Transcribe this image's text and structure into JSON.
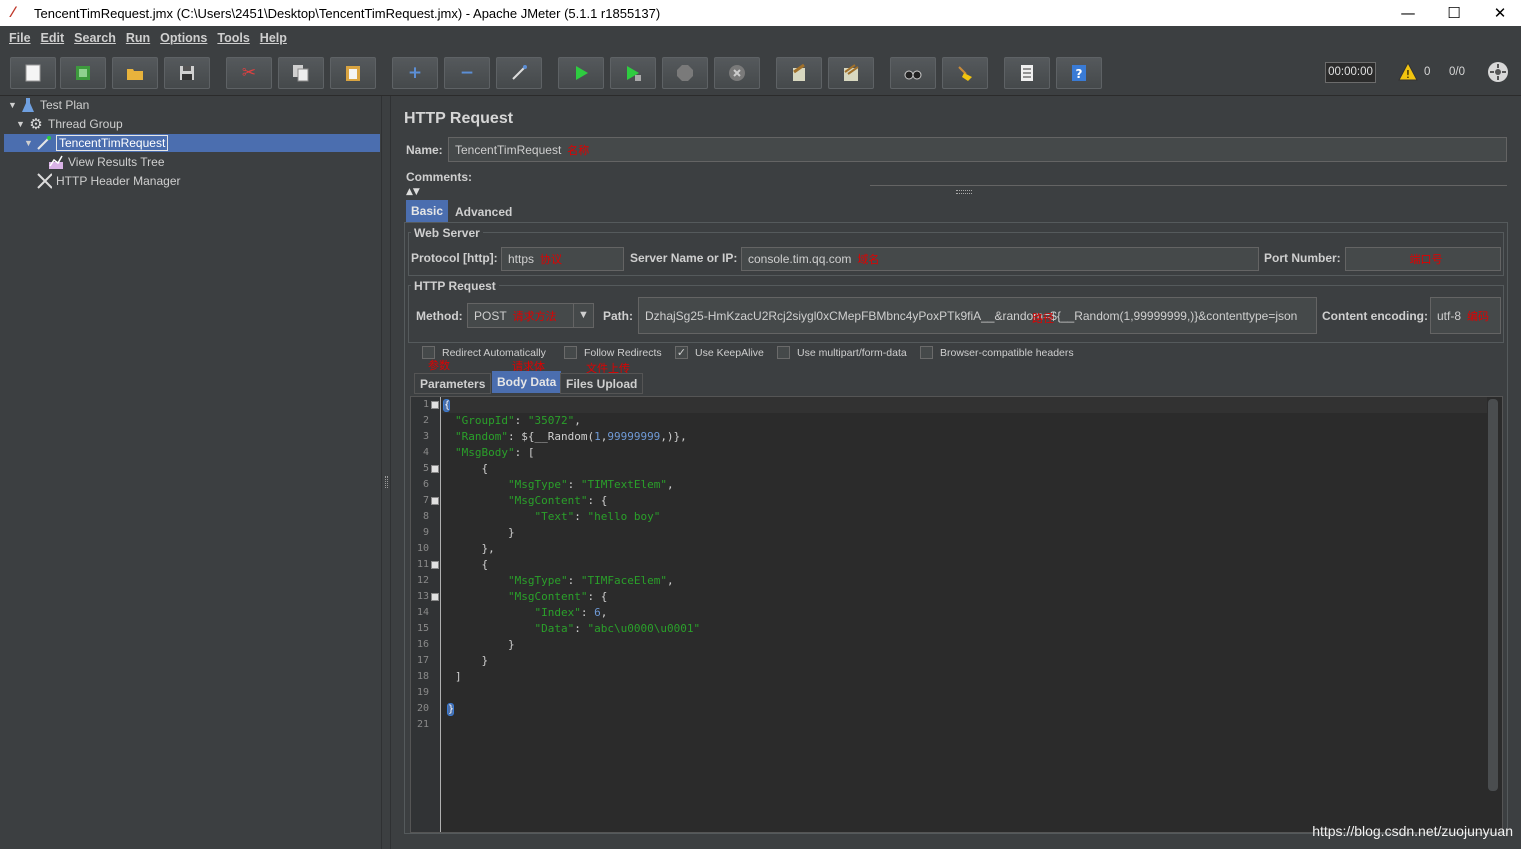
{
  "window": {
    "title": "TencentTimRequest.jmx (C:\\Users\\2451\\Desktop\\TencentTimRequest.jmx) - Apache JMeter (5.1.1 r1855137)",
    "minimize": "—",
    "maximize": "☐",
    "close": "✕"
  },
  "menu": [
    "File",
    "Edit",
    "Search",
    "Run",
    "Options",
    "Tools",
    "Help"
  ],
  "toolbar": {
    "buttons": [
      {
        "name": "new",
        "icon": "new-document-icon"
      },
      {
        "name": "templates",
        "icon": "templates-icon"
      },
      {
        "name": "open",
        "icon": "open-folder-icon"
      },
      {
        "name": "save",
        "icon": "save-icon"
      },
      {
        "name": "cut",
        "icon": "cut-icon"
      },
      {
        "name": "copy",
        "icon": "copy-icon"
      },
      {
        "name": "paste",
        "icon": "paste-icon"
      },
      {
        "name": "expand",
        "icon": "plus-icon"
      },
      {
        "name": "collapse",
        "icon": "minus-icon"
      },
      {
        "name": "toggle",
        "icon": "toggle-icon"
      },
      {
        "name": "start",
        "icon": "play-icon"
      },
      {
        "name": "start-no-pauses",
        "icon": "play-no-pause-icon"
      },
      {
        "name": "stop",
        "icon": "stop-icon"
      },
      {
        "name": "shutdown",
        "icon": "shutdown-icon"
      },
      {
        "name": "clear",
        "icon": "clear-icon"
      },
      {
        "name": "clear-all",
        "icon": "clear-all-icon"
      },
      {
        "name": "search",
        "icon": "binoculars-icon"
      },
      {
        "name": "reset-search",
        "icon": "broom-icon"
      },
      {
        "name": "function-helper",
        "icon": "list-icon"
      },
      {
        "name": "help",
        "icon": "help-icon"
      }
    ],
    "timer": "00:00:00",
    "warnings": "0",
    "threads": "0/0",
    "colors": {
      "green": "#2ecc40",
      "red": "#c0392b",
      "yellow": "#f1c40f",
      "blue": "#3a7bd5"
    }
  },
  "tree": {
    "items": [
      {
        "label": "Test Plan",
        "icon": "flask-icon",
        "toggle": "▼"
      },
      {
        "label": "Thread Group",
        "icon": "gear-icon",
        "toggle": "▼"
      },
      {
        "label": "TencentTimRequest",
        "icon": "pipette-icon",
        "toggle": "▼"
      },
      {
        "label": "View Results Tree",
        "icon": "chart-icon",
        "toggle": ""
      },
      {
        "label": "HTTP Header Manager",
        "icon": "tools-icon",
        "toggle": ""
      }
    ]
  },
  "panel": {
    "title": "HTTP Request",
    "name_label": "Name:",
    "name_value": "TencentTimRequest",
    "name_note": "名称",
    "comments_label": "Comments:",
    "tabs": [
      "Basic",
      "Advanced"
    ],
    "web_server": {
      "title": "Web Server",
      "protocol_label": "Protocol [http]:",
      "protocol_value": "https",
      "protocol_note": "协议",
      "server_label": "Server Name or IP:",
      "server_value": "console.tim.qq.com",
      "server_note": "域名",
      "port_label": "Port Number:",
      "port_value": "",
      "port_note": "端口号"
    },
    "http_request": {
      "title": "HTTP Request",
      "method_label": "Method:",
      "method_value": "POST",
      "method_note": "请求方法",
      "path_label": "Path:",
      "path_value": "DzhajSg25-HmKzacU2Rcj2siygl0xCMepFBMbnc4yPoxPTk9fiA__&random=${__Random(1,99999999,)}&contenttype=json",
      "path_note": "路径",
      "encoding_label": "Content encoding:",
      "encoding_value": "utf-8",
      "encoding_note": "编码"
    },
    "checkboxes": [
      {
        "label": "Redirect Automatically",
        "checked": false
      },
      {
        "label": "Follow Redirects",
        "checked": false
      },
      {
        "label": "Use KeepAlive",
        "checked": true
      },
      {
        "label": "Use multipart/form-data",
        "checked": false
      },
      {
        "label": "Browser-compatible headers",
        "checked": false
      }
    ],
    "sub_tabs": [
      "Parameters",
      "Body Data",
      "Files Upload"
    ],
    "sub_tab_notes": [
      "参数",
      "请求体",
      "文件上传"
    ]
  },
  "editor": {
    "line_numbers": [
      "1",
      "2",
      "3",
      "4",
      "5",
      "6",
      "7",
      "8",
      "9",
      "10",
      "11",
      "12",
      "13",
      "14",
      "15",
      "16",
      "17",
      "18",
      "19",
      "20",
      "21"
    ]
  },
  "watermark": "https://blog.csdn.net/zuojunyuan"
}
